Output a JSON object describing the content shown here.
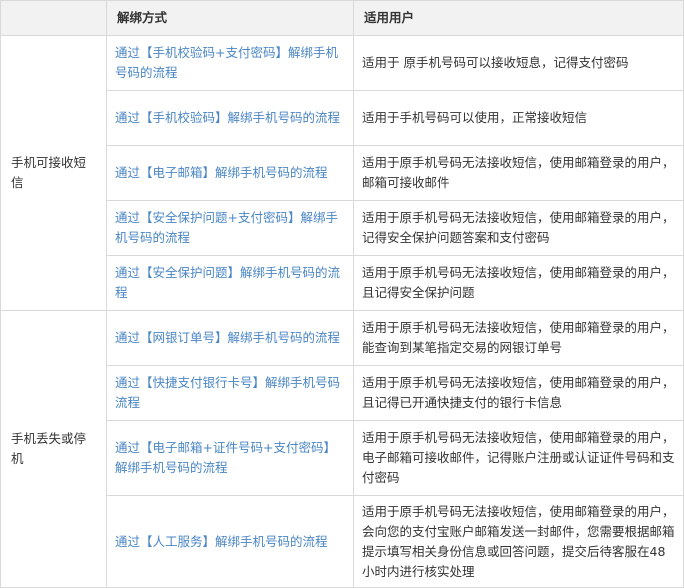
{
  "headers": [
    "",
    "解绑方式",
    "适用用户"
  ],
  "groups": [
    {
      "label": "手机可接收短信",
      "rows": [
        {
          "method": "通过【手机校验码+支付密码】解绑手机号码的流程",
          "user": "适用于 原手机号码可以接收短息，记得支付密码"
        },
        {
          "method": "通过【手机校验码】解绑手机号码的流程",
          "user": "适用于手机号码可以使用，正常接收短信"
        },
        {
          "method": "通过【电子邮箱】解绑手机号码的流程",
          "user": "适用于原手机号码无法接收短信，使用邮箱登录的用户，邮箱可接收邮件"
        },
        {
          "method": "通过【安全保护问题+支付密码】解绑手机号码的流程",
          "user": "适用于原手机号码无法接收短信，使用邮箱登录的用户，记得安全保护问题答案和支付密码"
        },
        {
          "method": "通过【安全保护问题】解绑手机号码的流程",
          "user": "适用于原手机号码无法接收短信，使用邮箱登录的用户，且记得安全保护问题"
        }
      ]
    },
    {
      "label": "手机丢失或停机",
      "rows": [
        {
          "method": "通过【网银订单号】解绑手机号码的流程",
          "user": "适用于原手机号码无法接收短信，使用邮箱登录的用户，能查询到某笔指定交易的网银订单号"
        },
        {
          "method": "通过【快捷支付银行卡号】解绑手机号码流程",
          "user": "适用于原手机号码无法接收短信，使用邮箱登录的用户，且记得已开通快捷支付的银行卡信息"
        },
        {
          "method": "通过【电子邮箱+证件号码+支付密码】解绑手机号码的流程",
          "user": "适用于原手机号码无法接收短信，使用邮箱登录的用户，电子邮箱可接收邮件，记得账户注册或认证证件号码和支付密码"
        },
        {
          "method": "通过【人工服务】解绑手机号码的流程",
          "user": "适用于原手机号码无法接收短信，使用邮箱登录的用户，会向您的支付宝账户邮箱发送一封邮件，您需要根据邮箱提示填写相关身份信息或回答问题，提交后待客服在48小时内进行核实处理"
        }
      ]
    }
  ]
}
